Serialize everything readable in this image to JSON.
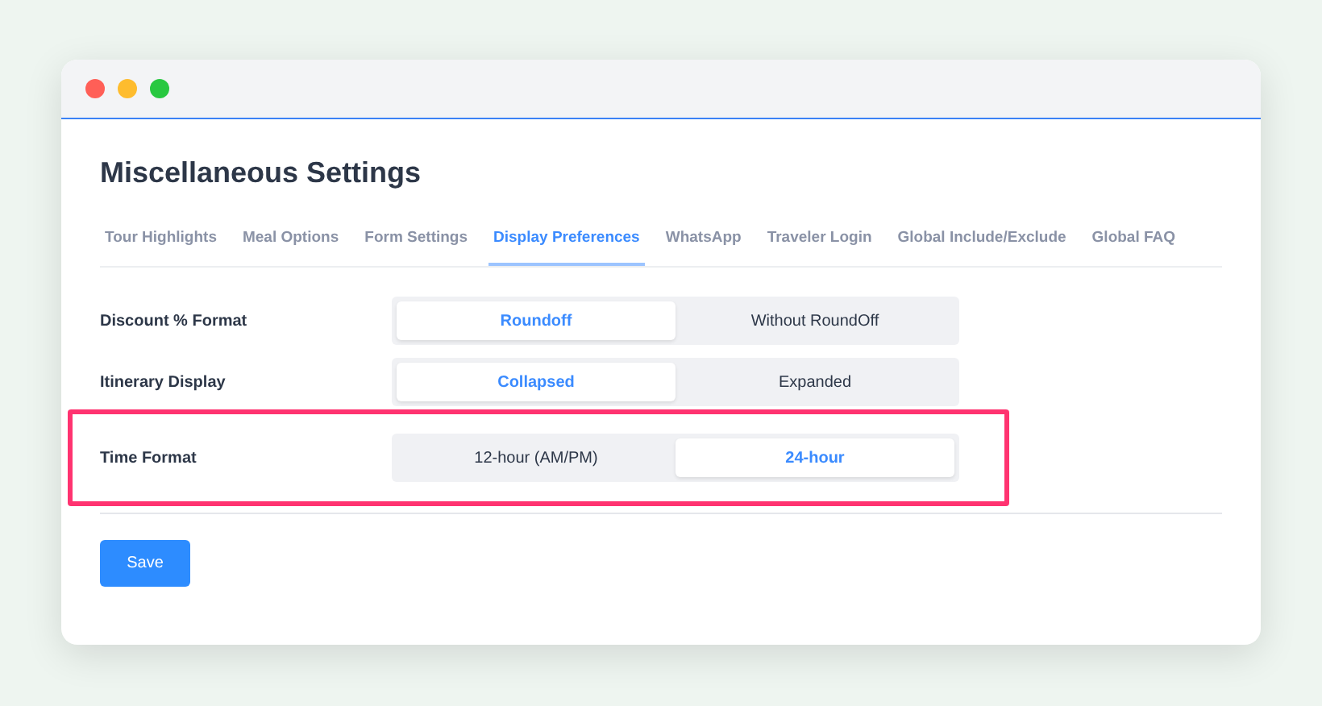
{
  "page": {
    "title": "Miscellaneous Settings"
  },
  "tabs": [
    {
      "label": "Tour Highlights",
      "selected": false
    },
    {
      "label": "Meal Options",
      "selected": false
    },
    {
      "label": "Form Settings",
      "selected": false
    },
    {
      "label": "Display Preferences",
      "selected": true
    },
    {
      "label": "WhatsApp",
      "selected": false
    },
    {
      "label": "Traveler Login",
      "selected": false
    },
    {
      "label": "Global Include/Exclude",
      "selected": false
    },
    {
      "label": "Global FAQ",
      "selected": false
    }
  ],
  "settings": [
    {
      "label": "Discount % Format",
      "highlighted": false,
      "options": [
        {
          "label": "Roundoff",
          "selected": true
        },
        {
          "label": "Without RoundOff",
          "selected": false
        }
      ]
    },
    {
      "label": "Itinerary Display",
      "highlighted": false,
      "options": [
        {
          "label": "Collapsed",
          "selected": true
        },
        {
          "label": "Expanded",
          "selected": false
        }
      ]
    },
    {
      "label": "Time Format",
      "highlighted": true,
      "options": [
        {
          "label": "12-hour (AM/PM)",
          "selected": false
        },
        {
          "label": "24-hour",
          "selected": true
        }
      ]
    }
  ],
  "save_button": "Save"
}
